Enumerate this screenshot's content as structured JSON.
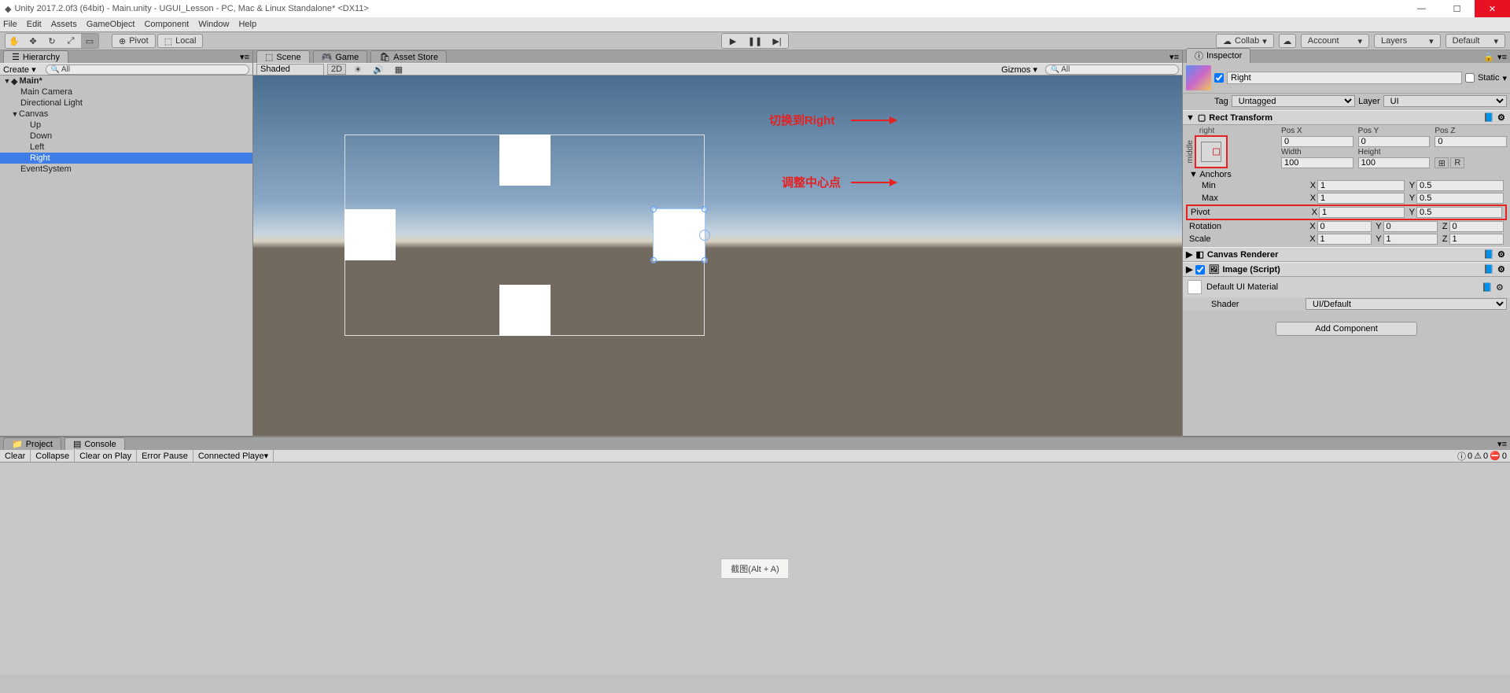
{
  "window": {
    "title": "Unity 2017.2.0f3 (64bit) - Main.unity - UGUI_Lesson - PC, Mac & Linux Standalone* <DX11>",
    "min": "—",
    "max": "☐",
    "close": "✕"
  },
  "menubar": [
    "File",
    "Edit",
    "Assets",
    "GameObject",
    "Component",
    "Window",
    "Help"
  ],
  "toolbar": {
    "pivot": "Pivot",
    "local": "Local",
    "collab": "Collab",
    "account": "Account",
    "layers": "Layers",
    "layout": "Default"
  },
  "hierarchy": {
    "tab": "Hierarchy",
    "create": "Create",
    "scene": "Main*",
    "items": [
      {
        "label": "Main Camera",
        "depth": 1
      },
      {
        "label": "Directional Light",
        "depth": 1
      },
      {
        "label": "Canvas",
        "depth": 1,
        "arrow": "▼"
      },
      {
        "label": "Up",
        "depth": 2
      },
      {
        "label": "Down",
        "depth": 2
      },
      {
        "label": "Left",
        "depth": 2
      },
      {
        "label": "Right",
        "depth": 2,
        "selected": true
      },
      {
        "label": "EventSystem",
        "depth": 1
      }
    ]
  },
  "scene_tabs": {
    "scene": "Scene",
    "game": "Game",
    "asset": "Asset Store"
  },
  "scene_toolbar": {
    "shaded": "Shaded",
    "twod": "2D",
    "gizmos": "Gizmos",
    "all": "All"
  },
  "inspector": {
    "tab": "Inspector",
    "name": "Right",
    "static": "Static",
    "tag_label": "Tag",
    "tag_value": "Untagged",
    "layer_label": "Layer",
    "layer_value": "UI",
    "rect_transform": {
      "title": "Rect Transform",
      "anchor_text_top": "right",
      "anchor_text_side": "middle",
      "posx_label": "Pos X",
      "posy_label": "Pos Y",
      "posz_label": "Pos Z",
      "posx": "0",
      "posy": "0",
      "posz": "0",
      "width_label": "Width",
      "height_label": "Height",
      "width": "100",
      "height": "100",
      "r_btn": "R",
      "anchors": "Anchors",
      "min": "Min",
      "minx": "1",
      "miny": "0.5",
      "max": "Max",
      "maxx": "1",
      "maxy": "0.5",
      "pivot": "Pivot",
      "pivotx": "1",
      "pivoty": "0.5",
      "rotation": "Rotation",
      "rotx": "0",
      "roty": "0",
      "rotz": "0",
      "scale": "Scale",
      "scx": "1",
      "scy": "1",
      "scz": "1"
    },
    "canvas_renderer": "Canvas Renderer",
    "image": {
      "title": "Image (Script)",
      "material": "Default UI Material",
      "shader_label": "Shader",
      "shader_value": "UI/Default"
    },
    "add_component": "Add Component"
  },
  "annotations": {
    "a1": "切换到Right",
    "a2": "调整中心点"
  },
  "project": {
    "tab_project": "Project",
    "tab_console": "Console"
  },
  "console_toolbar": {
    "clear": "Clear",
    "collapse": "Collapse",
    "cop": "Clear on Play",
    "ep": "Error Pause",
    "cp": "Connected Playe",
    "zero": "0"
  },
  "hint": "截图(Alt + A)"
}
